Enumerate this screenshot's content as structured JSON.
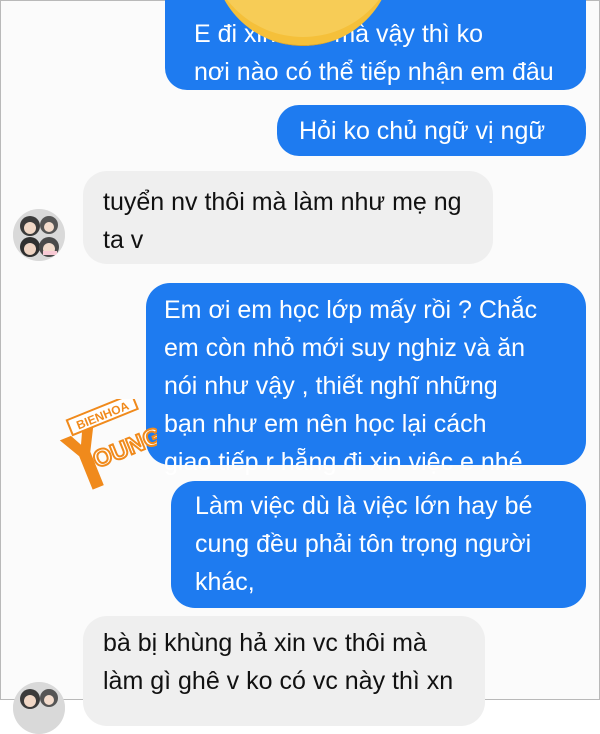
{
  "messages": [
    {
      "id": "m1",
      "side": "outgoing",
      "lines": [
        "E đi xin việc mà vậy thì ko",
        "nơi nào có thể tiếp nhận em đâu"
      ]
    },
    {
      "id": "m2",
      "side": "outgoing",
      "lines": [
        "Hỏi ko chủ ngữ vị ngữ"
      ]
    },
    {
      "id": "m3",
      "side": "incoming",
      "lines": [
        "tuyển nv thôi mà làm như mẹ ng",
        "ta v"
      ]
    },
    {
      "id": "m4",
      "side": "outgoing",
      "lines": [
        "Em ơi em học lớp mấy rồi ? Chắc",
        "em còn nhỏ mới suy nghiz và ăn",
        "nói như vậy , thiết nghĩ những",
        "bạn như em nên học lại cách",
        "giao tiếp r hẵng đi xin việc e nhé"
      ]
    },
    {
      "id": "m5",
      "side": "outgoing",
      "lines": [
        "Làm việc dù là việc lớn hay bé",
        "cung đều phải tôn trọng người",
        "khác,"
      ]
    },
    {
      "id": "m6",
      "side": "incoming",
      "lines": [
        "bà bị khùng hả xin vc thôi mà",
        "làm gì ghê v ko có vc này thì xn"
      ]
    }
  ],
  "watermark": {
    "line1": "BIENHOA",
    "line2": "OUNG",
    "letter": "Y"
  },
  "colors": {
    "outgoing": "#1e7bf0",
    "incoming": "#efefef",
    "emoji": "#f5c03a",
    "watermark": "#f08a1c"
  },
  "icons": {
    "avatar": "avatar-photo",
    "emoji": "emoji-sticker"
  }
}
